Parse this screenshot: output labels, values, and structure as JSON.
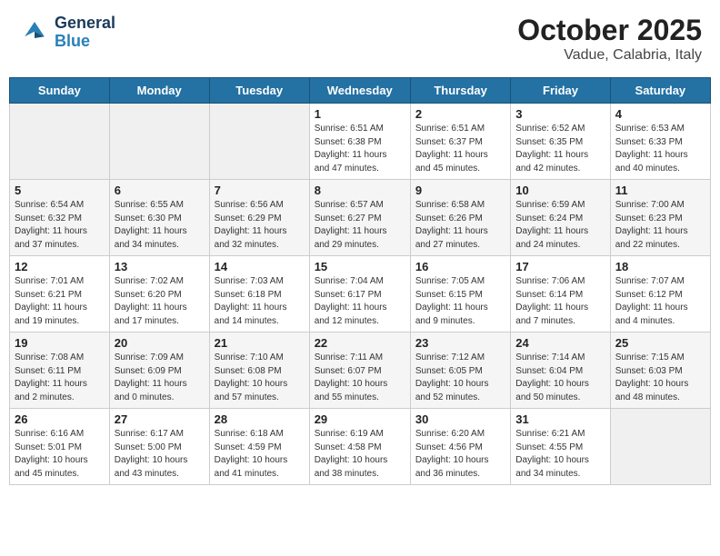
{
  "header": {
    "logo_general": "General",
    "logo_blue": "Blue",
    "title": "October 2025",
    "subtitle": "Vadue, Calabria, Italy"
  },
  "weekdays": [
    "Sunday",
    "Monday",
    "Tuesday",
    "Wednesday",
    "Thursday",
    "Friday",
    "Saturday"
  ],
  "weeks": [
    [
      {
        "day": "",
        "info": ""
      },
      {
        "day": "",
        "info": ""
      },
      {
        "day": "",
        "info": ""
      },
      {
        "day": "1",
        "info": "Sunrise: 6:51 AM\nSunset: 6:38 PM\nDaylight: 11 hours\nand 47 minutes."
      },
      {
        "day": "2",
        "info": "Sunrise: 6:51 AM\nSunset: 6:37 PM\nDaylight: 11 hours\nand 45 minutes."
      },
      {
        "day": "3",
        "info": "Sunrise: 6:52 AM\nSunset: 6:35 PM\nDaylight: 11 hours\nand 42 minutes."
      },
      {
        "day": "4",
        "info": "Sunrise: 6:53 AM\nSunset: 6:33 PM\nDaylight: 11 hours\nand 40 minutes."
      }
    ],
    [
      {
        "day": "5",
        "info": "Sunrise: 6:54 AM\nSunset: 6:32 PM\nDaylight: 11 hours\nand 37 minutes."
      },
      {
        "day": "6",
        "info": "Sunrise: 6:55 AM\nSunset: 6:30 PM\nDaylight: 11 hours\nand 34 minutes."
      },
      {
        "day": "7",
        "info": "Sunrise: 6:56 AM\nSunset: 6:29 PM\nDaylight: 11 hours\nand 32 minutes."
      },
      {
        "day": "8",
        "info": "Sunrise: 6:57 AM\nSunset: 6:27 PM\nDaylight: 11 hours\nand 29 minutes."
      },
      {
        "day": "9",
        "info": "Sunrise: 6:58 AM\nSunset: 6:26 PM\nDaylight: 11 hours\nand 27 minutes."
      },
      {
        "day": "10",
        "info": "Sunrise: 6:59 AM\nSunset: 6:24 PM\nDaylight: 11 hours\nand 24 minutes."
      },
      {
        "day": "11",
        "info": "Sunrise: 7:00 AM\nSunset: 6:23 PM\nDaylight: 11 hours\nand 22 minutes."
      }
    ],
    [
      {
        "day": "12",
        "info": "Sunrise: 7:01 AM\nSunset: 6:21 PM\nDaylight: 11 hours\nand 19 minutes."
      },
      {
        "day": "13",
        "info": "Sunrise: 7:02 AM\nSunset: 6:20 PM\nDaylight: 11 hours\nand 17 minutes."
      },
      {
        "day": "14",
        "info": "Sunrise: 7:03 AM\nSunset: 6:18 PM\nDaylight: 11 hours\nand 14 minutes."
      },
      {
        "day": "15",
        "info": "Sunrise: 7:04 AM\nSunset: 6:17 PM\nDaylight: 11 hours\nand 12 minutes."
      },
      {
        "day": "16",
        "info": "Sunrise: 7:05 AM\nSunset: 6:15 PM\nDaylight: 11 hours\nand 9 minutes."
      },
      {
        "day": "17",
        "info": "Sunrise: 7:06 AM\nSunset: 6:14 PM\nDaylight: 11 hours\nand 7 minutes."
      },
      {
        "day": "18",
        "info": "Sunrise: 7:07 AM\nSunset: 6:12 PM\nDaylight: 11 hours\nand 4 minutes."
      }
    ],
    [
      {
        "day": "19",
        "info": "Sunrise: 7:08 AM\nSunset: 6:11 PM\nDaylight: 11 hours\nand 2 minutes."
      },
      {
        "day": "20",
        "info": "Sunrise: 7:09 AM\nSunset: 6:09 PM\nDaylight: 11 hours\nand 0 minutes."
      },
      {
        "day": "21",
        "info": "Sunrise: 7:10 AM\nSunset: 6:08 PM\nDaylight: 10 hours\nand 57 minutes."
      },
      {
        "day": "22",
        "info": "Sunrise: 7:11 AM\nSunset: 6:07 PM\nDaylight: 10 hours\nand 55 minutes."
      },
      {
        "day": "23",
        "info": "Sunrise: 7:12 AM\nSunset: 6:05 PM\nDaylight: 10 hours\nand 52 minutes."
      },
      {
        "day": "24",
        "info": "Sunrise: 7:14 AM\nSunset: 6:04 PM\nDaylight: 10 hours\nand 50 minutes."
      },
      {
        "day": "25",
        "info": "Sunrise: 7:15 AM\nSunset: 6:03 PM\nDaylight: 10 hours\nand 48 minutes."
      }
    ],
    [
      {
        "day": "26",
        "info": "Sunrise: 6:16 AM\nSunset: 5:01 PM\nDaylight: 10 hours\nand 45 minutes."
      },
      {
        "day": "27",
        "info": "Sunrise: 6:17 AM\nSunset: 5:00 PM\nDaylight: 10 hours\nand 43 minutes."
      },
      {
        "day": "28",
        "info": "Sunrise: 6:18 AM\nSunset: 4:59 PM\nDaylight: 10 hours\nand 41 minutes."
      },
      {
        "day": "29",
        "info": "Sunrise: 6:19 AM\nSunset: 4:58 PM\nDaylight: 10 hours\nand 38 minutes."
      },
      {
        "day": "30",
        "info": "Sunrise: 6:20 AM\nSunset: 4:56 PM\nDaylight: 10 hours\nand 36 minutes."
      },
      {
        "day": "31",
        "info": "Sunrise: 6:21 AM\nSunset: 4:55 PM\nDaylight: 10 hours\nand 34 minutes."
      },
      {
        "day": "",
        "info": ""
      }
    ]
  ]
}
